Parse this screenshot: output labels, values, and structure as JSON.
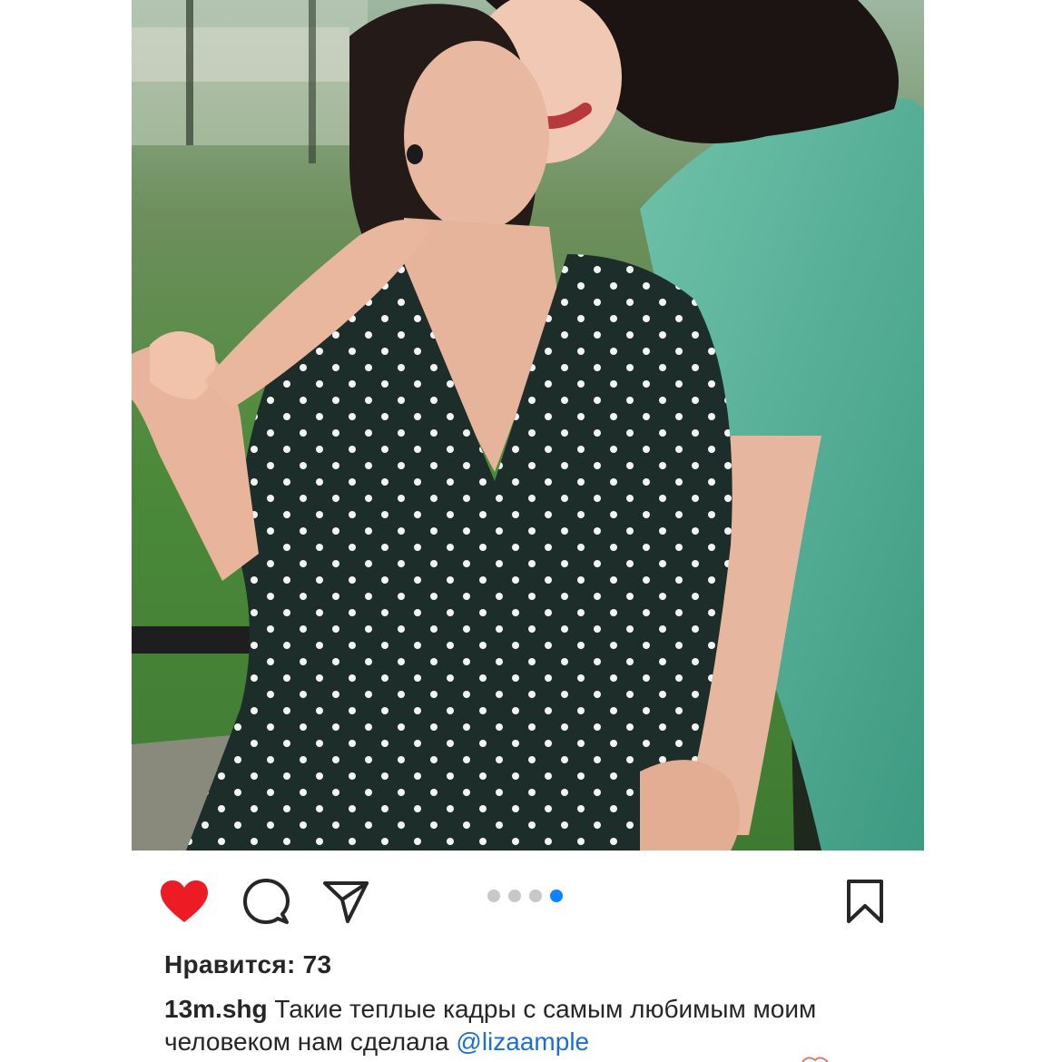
{
  "post": {
    "image": {
      "icon": "photo-two-women-garden",
      "carousel_total": 4,
      "carousel_active": 4
    },
    "actions": {
      "like_icon": "heart-filled-icon",
      "like_color": "#ed1c24",
      "liked": true,
      "comment_icon": "comment-bubble-icon",
      "share_icon": "paper-plane-icon",
      "save_icon": "bookmark-icon",
      "active_dot_color": "#0a84ff"
    },
    "likes_label": "Нравится: 73",
    "caption": {
      "username": "13m.shg",
      "text": " Такие теплые кадры с самым любимым моим человеком нам сделала ",
      "mention": "@lizaample",
      "mention_color": "#1c6fd1"
    }
  }
}
